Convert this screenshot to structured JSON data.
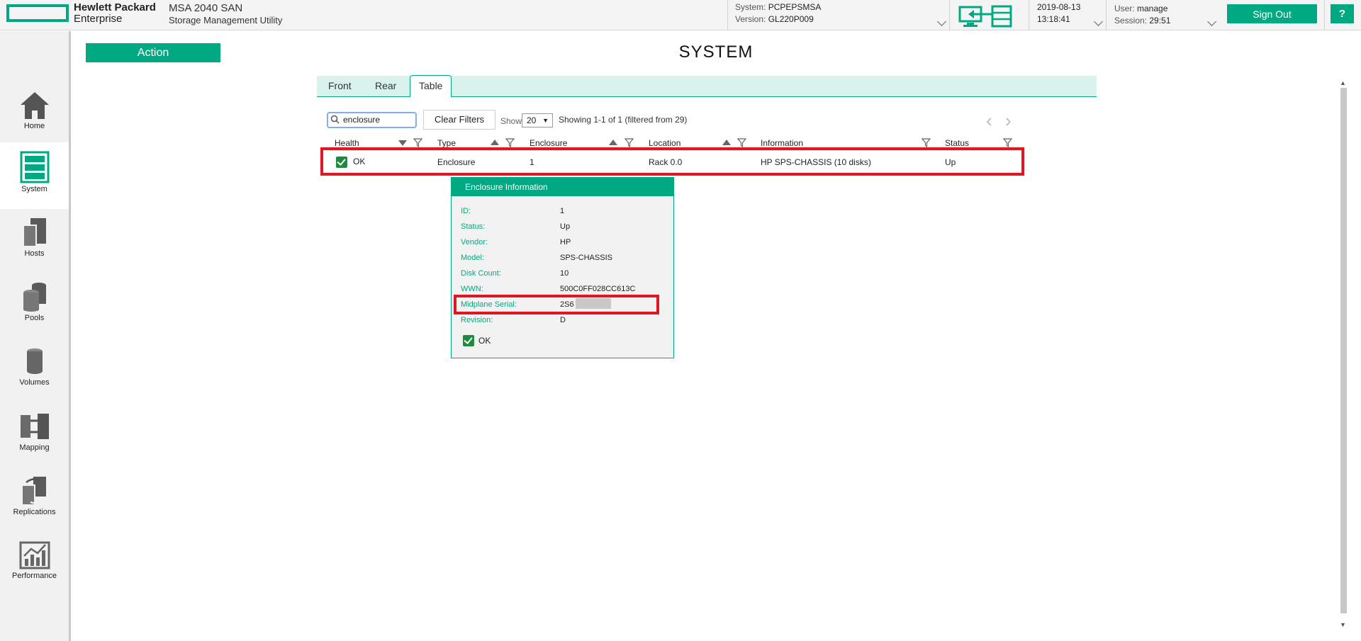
{
  "header": {
    "brand_line1": "Hewlett Packard",
    "brand_line2": "Enterprise",
    "product_line1": "MSA 2040 SAN",
    "product_line2": "Storage Management Utility",
    "system_label": "System:",
    "system_value": "PCPEPSMSA",
    "version_label": "Version:",
    "version_value": "GL220P009",
    "date": "2019-08-13",
    "time": "13:18:41",
    "user_label": "User:",
    "user_value": "manage",
    "session_label": "Session:",
    "session_value": "29:51",
    "sign_out": "Sign Out",
    "help": "?"
  },
  "sidebar": {
    "items": [
      {
        "label": "Home",
        "icon": "home-icon"
      },
      {
        "label": "System",
        "icon": "system-icon",
        "active": true
      },
      {
        "label": "Hosts",
        "icon": "hosts-icon"
      },
      {
        "label": "Pools",
        "icon": "pools-icon"
      },
      {
        "label": "Volumes",
        "icon": "volumes-icon"
      },
      {
        "label": "Mapping",
        "icon": "mapping-icon"
      },
      {
        "label": "Replications",
        "icon": "replications-icon"
      },
      {
        "label": "Performance",
        "icon": "performance-icon"
      }
    ]
  },
  "main": {
    "action_label": "Action",
    "title": "SYSTEM",
    "tabs": [
      {
        "label": "Front"
      },
      {
        "label": "Rear"
      },
      {
        "label": "Table",
        "active": true
      }
    ],
    "search_value": "enclosure",
    "clear_filters": "Clear Filters",
    "show_label": "Show",
    "show_value": "20",
    "showing_text": "Showing 1-1 of 1 (filtered from 29)",
    "columns": [
      "Health",
      "Type",
      "Enclosure",
      "Location",
      "Information",
      "Status"
    ],
    "rows": [
      {
        "health": "OK",
        "type": "Enclosure",
        "enclosure": "1",
        "location": "Rack 0.0",
        "information": "HP SPS-CHASSIS (10 disks)",
        "status": "Up"
      }
    ]
  },
  "popup": {
    "title": "Enclosure Information",
    "fields": [
      {
        "key": "ID:",
        "value": "1"
      },
      {
        "key": "Status:",
        "value": "Up"
      },
      {
        "key": "Vendor:",
        "value": "HP"
      },
      {
        "key": "Model:",
        "value": "SPS-CHASSIS"
      },
      {
        "key": "Disk Count:",
        "value": "10"
      },
      {
        "key": "WWN:",
        "value": "500C0FF028CC613C"
      },
      {
        "key": "Midplane Serial:",
        "value": "2S6"
      },
      {
        "key": "Revision:",
        "value": "D"
      }
    ],
    "health": "OK"
  },
  "colors": {
    "accent": "#01a982",
    "highlight": "#e01622",
    "ok_green": "#1e8a3c"
  }
}
